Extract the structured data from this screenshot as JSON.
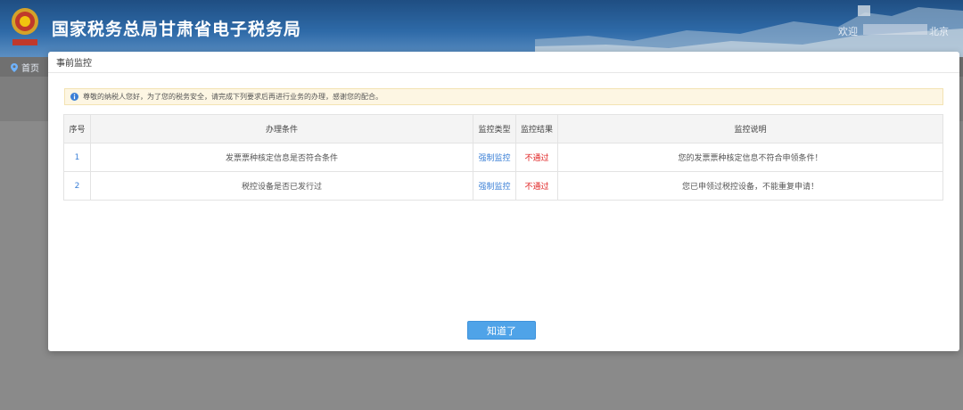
{
  "header": {
    "site_title": "国家税务总局甘肃省电子税务局",
    "welcome": "欢迎",
    "user_suffix": "北京"
  },
  "nav": {
    "home_label": "首页"
  },
  "modal": {
    "title": "事前监控",
    "notice": "尊敬的纳税人您好，为了您的税务安全，请完成下列要求后再进行业务的办理，感谢您的配合。",
    "ok_label": "知道了"
  },
  "table": {
    "headers": [
      "序号",
      "办理条件",
      "监控类型",
      "监控结果",
      "监控说明"
    ],
    "rows": [
      {
        "idx": "1",
        "condition": "发票票种核定信息是否符合条件",
        "type": "强制监控",
        "result": "不通过",
        "desc": "您的发票票种核定信息不符合申领条件！"
      },
      {
        "idx": "2",
        "condition": "税控设备是否已发行过",
        "type": "强制监控",
        "result": "不通过",
        "desc": "您已申领过税控设备，不能重复申请！"
      }
    ]
  },
  "colors": {
    "accent": "#4fa3e8",
    "link": "#3a7fd6",
    "fail": "#e02020",
    "notice_bg": "#fdf6e3"
  }
}
